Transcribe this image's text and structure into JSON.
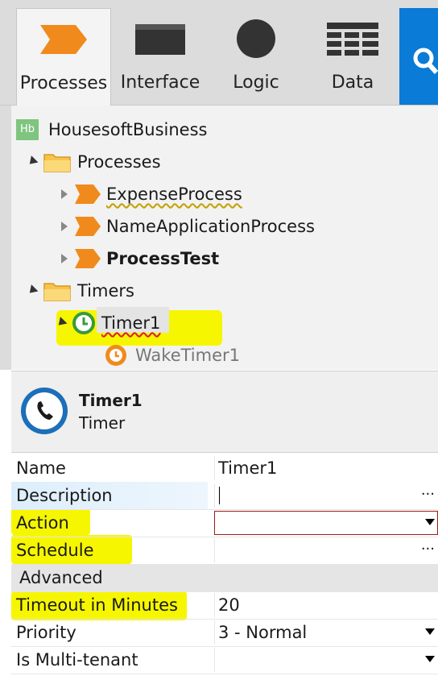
{
  "tabs": [
    {
      "label": "Processes",
      "icon": "process-icon",
      "active": true
    },
    {
      "label": "Interface",
      "icon": "window-icon",
      "active": false
    },
    {
      "label": "Logic",
      "icon": "circle-icon",
      "active": false
    },
    {
      "label": "Data",
      "icon": "grid-icon",
      "active": false
    }
  ],
  "search": {
    "icon": "search-icon",
    "color": "#0a7bd6"
  },
  "tree": {
    "root": {
      "badge": "Hb",
      "label": "HousesoftBusiness"
    },
    "processes_folder": "Processes",
    "processes": [
      "ExpenseProcess",
      "NameApplicationProcess",
      "ProcessTest"
    ],
    "timers_folder": "Timers",
    "timer": "Timer1",
    "wake": "WakeTimer1"
  },
  "details": {
    "title": "Timer1",
    "subtitle": "Timer"
  },
  "props": {
    "name_k": "Name",
    "name_v": "Timer1",
    "desc_k": "Description",
    "desc_v": "",
    "action_k": "Action",
    "action_v": "",
    "sched_k": "Schedule",
    "sched_v": "",
    "advanced": "Advanced",
    "timeout_k": "Timeout in Minutes",
    "timeout_v": "20",
    "priority_k": "Priority",
    "priority_v": "3 - Normal",
    "multi_k": "Is Multi-tenant",
    "multi_v": ""
  },
  "colors": {
    "process_orange": "#f08a1c",
    "highlight": "#f6f600",
    "timer_green": "#3a9a3a"
  }
}
